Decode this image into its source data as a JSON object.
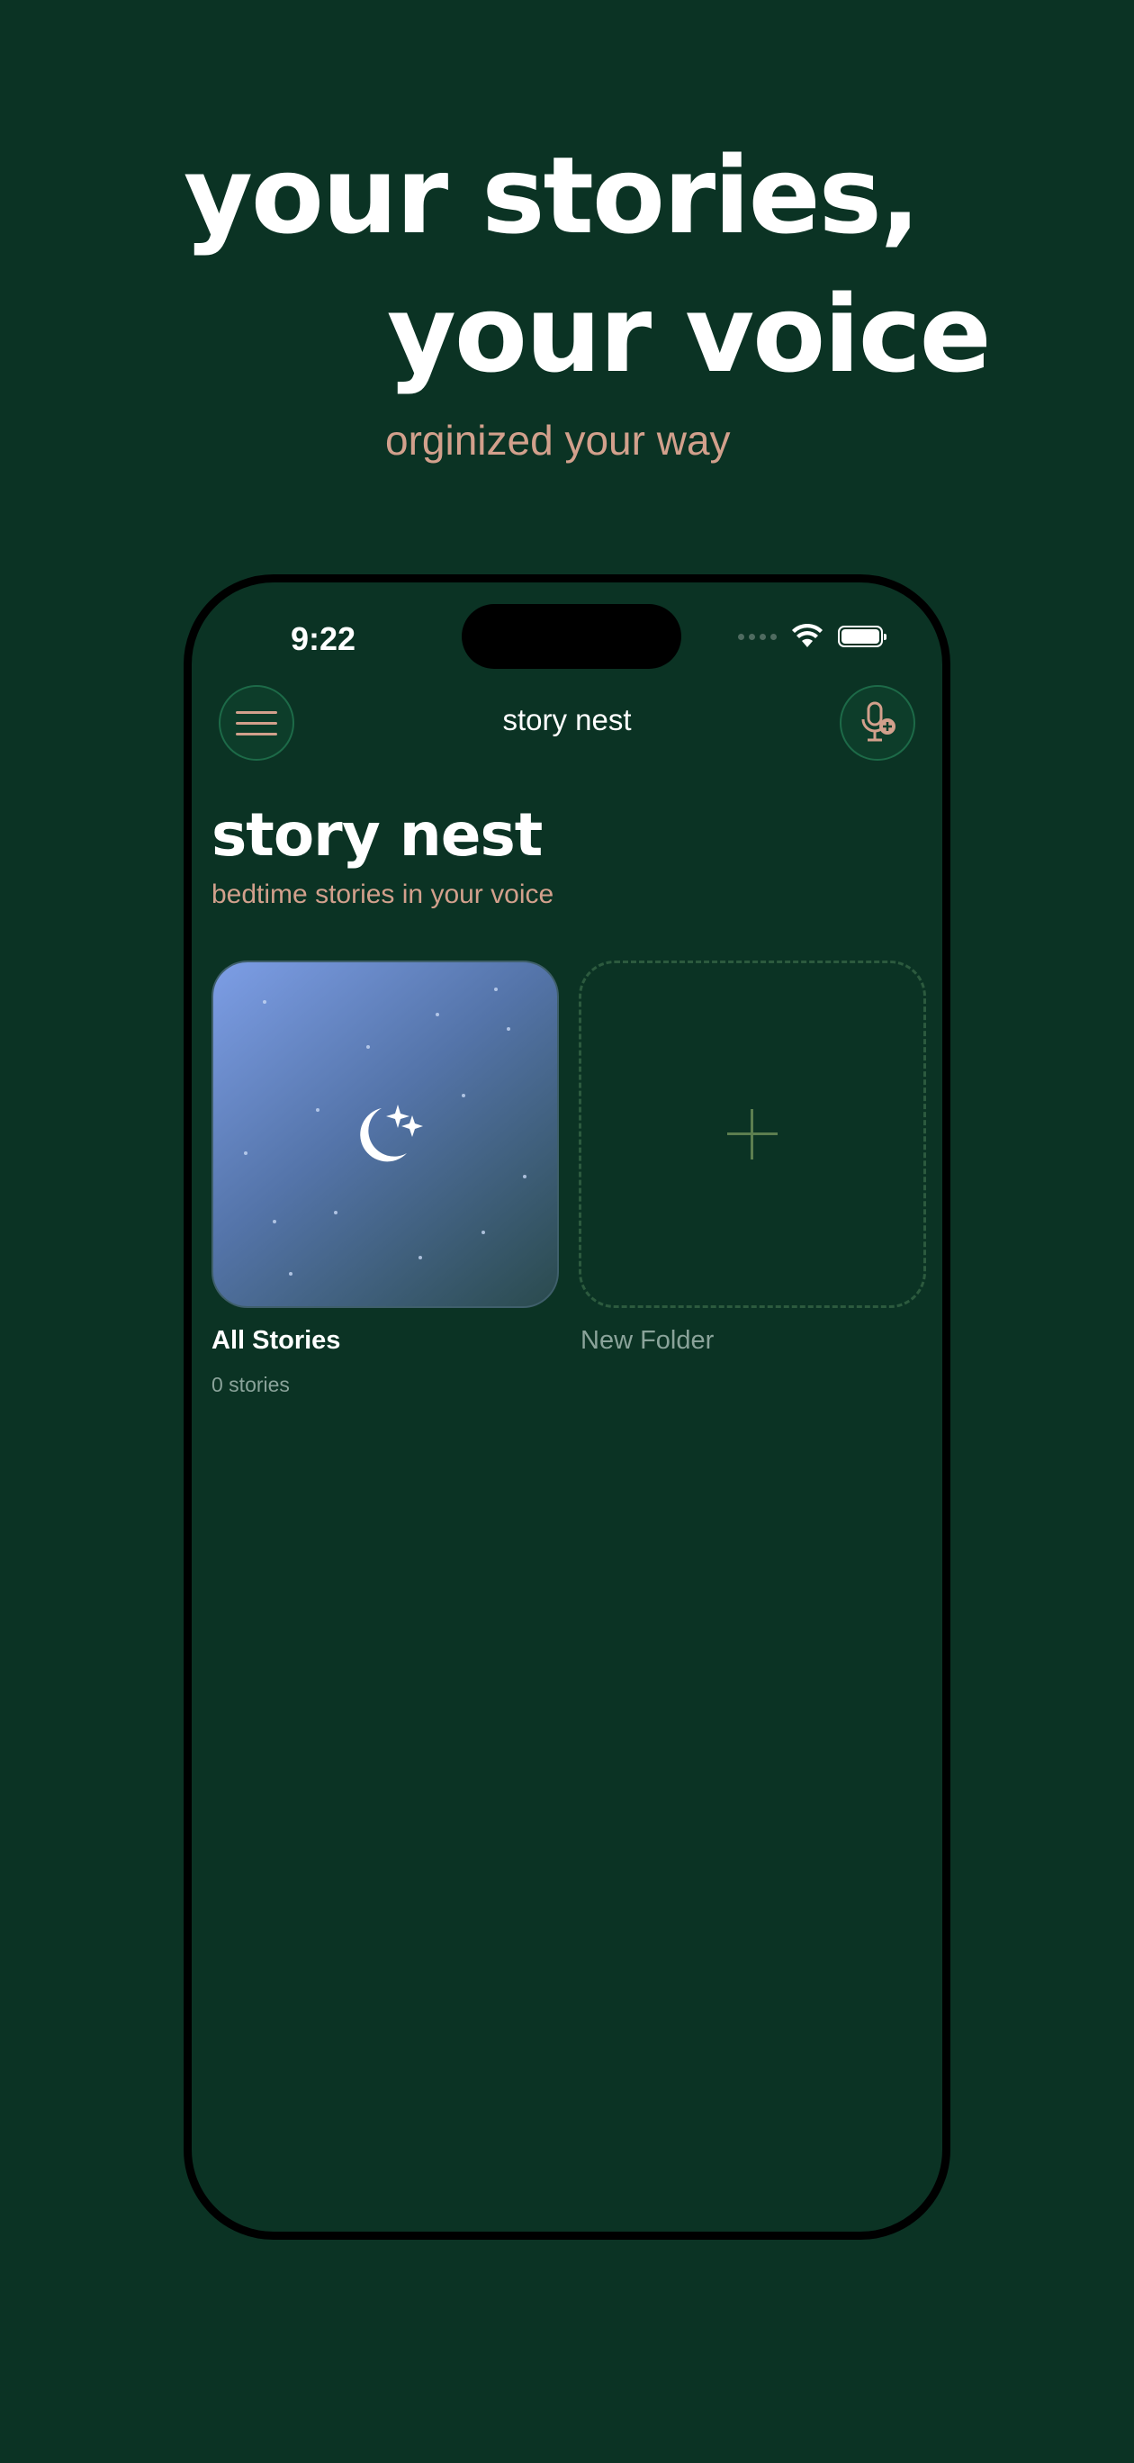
{
  "marketing": {
    "headline_line1": "your stories,",
    "headline_line2": "your voice",
    "tagline": "orginized your way"
  },
  "status_bar": {
    "time": "9:22"
  },
  "nav": {
    "title": "story nest",
    "menu_icon": "hamburger-icon",
    "mic_icon": "mic-add-icon"
  },
  "header": {
    "title": "story nest",
    "subtitle": "bedtime stories in your voice"
  },
  "folders": [
    {
      "name": "All Stories",
      "count": "0 stories",
      "icon": "moon-stars-icon"
    },
    {
      "name": "New Folder",
      "icon": "plus-icon"
    }
  ],
  "colors": {
    "background": "#0b3324",
    "accent": "#d2a08c",
    "button_border": "#1d6a48"
  }
}
